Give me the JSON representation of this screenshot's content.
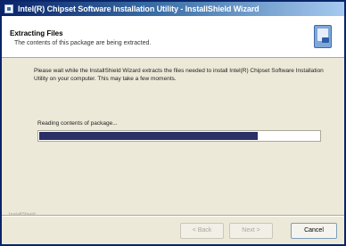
{
  "window": {
    "title": "Intel(R) Chipset Software Installation Utility - InstallShield Wizard"
  },
  "header": {
    "title": "Extracting Files",
    "subtitle": "The contents of this package are being extracted.",
    "icon": "installer-box-icon"
  },
  "body": {
    "message": "Please wait while the InstallShield Wizard extracts the files needed to install Intel(R) Chipset Software Installation Utility on your computer. This may take a few moments."
  },
  "progress": {
    "label": "Reading contents of package...",
    "fraction": 0.78,
    "fill_color": "#2a2f66"
  },
  "footer": {
    "brand": "InstallShield"
  },
  "buttons": {
    "back": "< Back",
    "next": "Next >",
    "cancel": "Cancel"
  }
}
